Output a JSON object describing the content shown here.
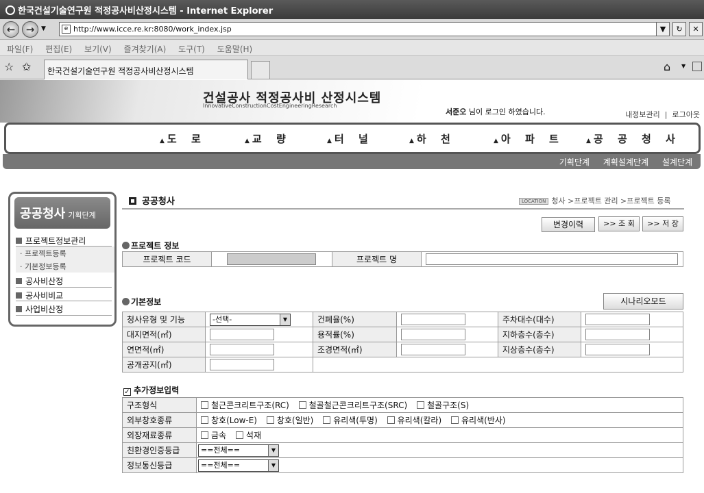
{
  "browser": {
    "window_title": "한국건설기술연구원 적정공사비산정시스템 - Internet Explorer",
    "url": "http://www.icce.re.kr:8080/work_index.jsp",
    "menu": [
      "파일(F)",
      "편집(E)",
      "보기(V)",
      "즐겨찾기(A)",
      "도구(T)",
      "도움말(H)"
    ],
    "tab_title": "한국건설기술연구원 적정공사비산정시스템"
  },
  "header": {
    "system_title": "건설공사 적정공사비 산정시스템",
    "system_subtitle": "InnovativeConstructionCostEngineeringResearch",
    "login_user": "서준오",
    "login_msg": " 님이 로그인 하였습니다.",
    "link_myinfo": "내정보관리",
    "link_separator": "|",
    "link_logout": "로그아웃"
  },
  "nav": {
    "items": [
      "도 로",
      "교 량",
      "터 널",
      "하 천",
      "아 파 트",
      "공 공 청 사"
    ],
    "stages": [
      "기획단계",
      "계획설계단계",
      "설계단계"
    ]
  },
  "sidebar": {
    "title": "공공청사",
    "stage": "기획단계",
    "menu1": "프로젝트정보관리",
    "sub1": "· 프로젝트등록",
    "sub2": "· 기본정보등록",
    "menu2": "공사비산정",
    "menu3": "공사비비교",
    "menu4": "사업비산정"
  },
  "content": {
    "title": "공공청사",
    "location_badge": "LOCATION",
    "location": "청사 >프로젝트 관리 >프로젝트 등록",
    "btn_history": "변경이력",
    "btn_search": ">> 조 회",
    "btn_save": ">> 저 장",
    "sec_project": "프로젝트 정보",
    "lbl_project_code": "프로젝트 코드",
    "lbl_project_name": "프로젝트 명",
    "sec_basic": "기본정보",
    "btn_scenario": "시나리오모드",
    "lbl_type": "청사유형 및 기능",
    "sel_type": "-선택-",
    "lbl_coverage": "건폐율(%)",
    "lbl_parking": "주차대수(대수)",
    "lbl_site_area": "대지면적(㎡)",
    "lbl_far": "용적률(%)",
    "lbl_basement": "지하층수(층수)",
    "lbl_floor_area": "연면적(㎡)",
    "lbl_landscape": "조경면적(㎡)",
    "lbl_above": "지상층수(층수)",
    "lbl_public": "공개공지(㎡)",
    "sec_extra": "추가정보입력",
    "lbl_structure": "구조형식",
    "opt_rc": "철근콘크리트구조(RC)",
    "opt_src": "철골철근콘크리트구조(SRC)",
    "opt_s": "철골구조(S)",
    "lbl_window": "외부창호종류",
    "opt_lowe": "창호(Low-E)",
    "opt_normal": "창호(일반)",
    "opt_clear": "유리색(투명)",
    "opt_color": "유리색(칼라)",
    "opt_reflect": "유리색(반사)",
    "lbl_exterior": "외장재료종류",
    "opt_metal": "금속",
    "opt_stone": "석재",
    "lbl_eco": "친환경인증등급",
    "sel_eco": "==전체==",
    "lbl_ict": "정보통신등급",
    "sel_ict": "==전체=="
  }
}
